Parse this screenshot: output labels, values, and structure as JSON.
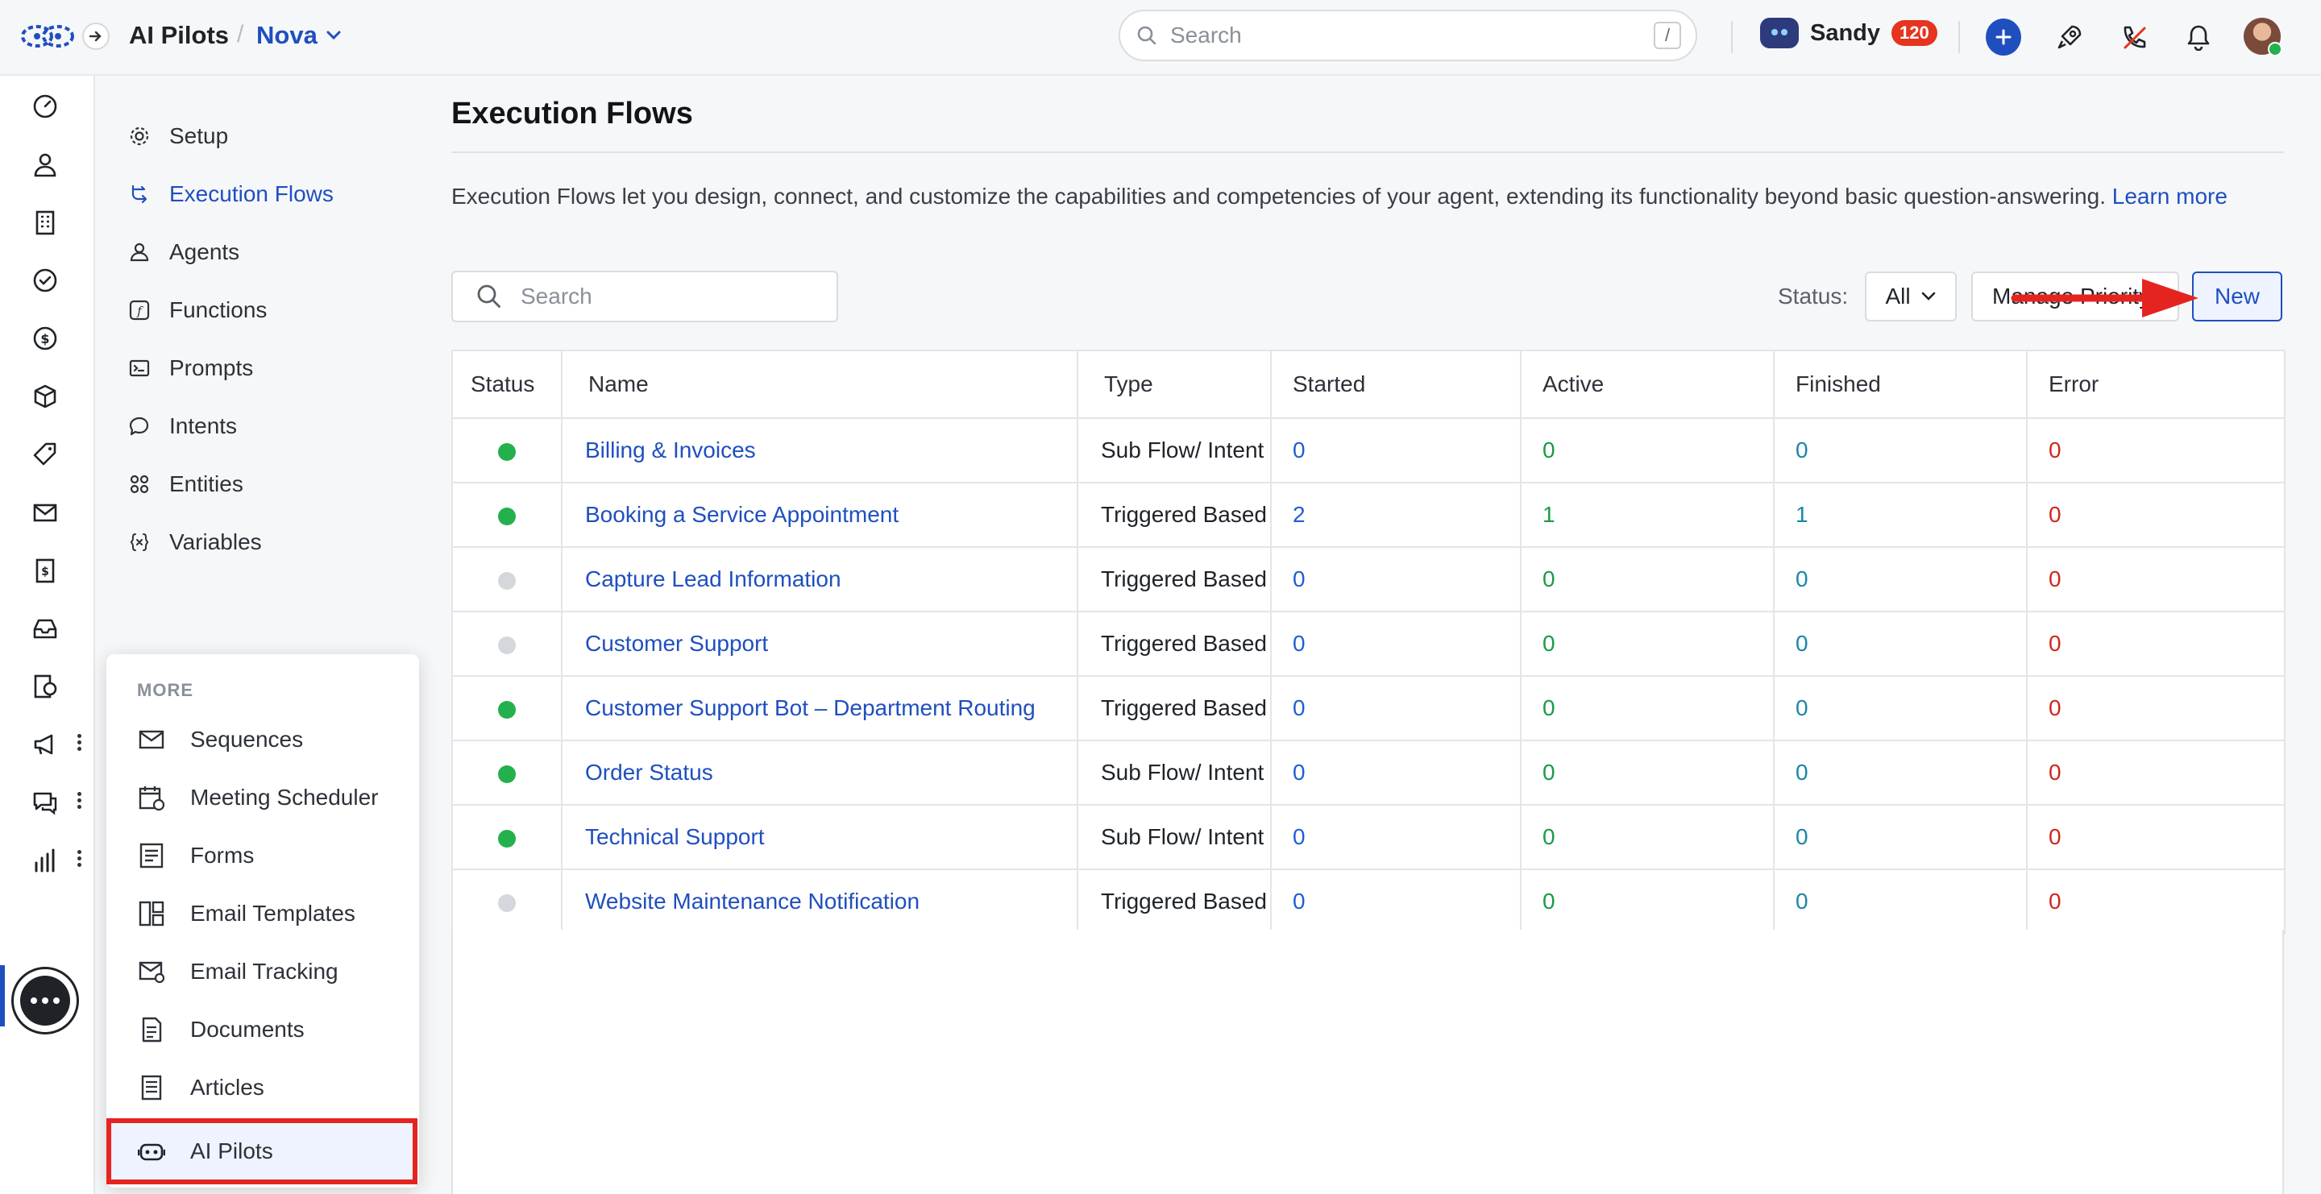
{
  "header": {
    "app_title": "AI Pilots",
    "crumb_separator": "/",
    "app_name": "Nova",
    "search_placeholder": "Search",
    "search_shortcut": "/",
    "user_name": "Sandy",
    "user_badge": "120"
  },
  "subnav": {
    "items": [
      {
        "label": "Setup",
        "icon": "gear-icon"
      },
      {
        "label": "Execution Flows",
        "icon": "flow-icon",
        "active": true
      },
      {
        "label": "Agents",
        "icon": "agent-icon"
      },
      {
        "label": "Functions",
        "icon": "function-icon"
      },
      {
        "label": "Prompts",
        "icon": "prompt-icon"
      },
      {
        "label": "Intents",
        "icon": "intent-icon"
      },
      {
        "label": "Entities",
        "icon": "entity-icon"
      },
      {
        "label": "Variables",
        "icon": "variable-icon"
      }
    ]
  },
  "main": {
    "title": "Execution Flows",
    "intro_text": "Execution Flows let you design, connect, and customize the capabilities and competencies of your agent, extending its functionality beyond basic question-answering.",
    "intro_link": "Learn more",
    "search_placeholder": "Search",
    "status_label": "Status:",
    "status_value": "All",
    "manage_priority_label": "Manage Priority",
    "new_label": "New"
  },
  "table": {
    "columns": [
      "Status",
      "Name",
      "Type",
      "Started",
      "Active",
      "Finished",
      "Error"
    ],
    "rows": [
      {
        "status": "on",
        "name": "Billing & Invoices",
        "type": "Sub Flow/ Intent",
        "started": "0",
        "active": "0",
        "finished": "0",
        "error": "0"
      },
      {
        "status": "on",
        "name": "Booking a Service Appointment",
        "type": "Triggered Based",
        "started": "2",
        "active": "1",
        "finished": "1",
        "error": "0"
      },
      {
        "status": "off",
        "name": "Capture Lead Information",
        "type": "Triggered Based",
        "started": "0",
        "active": "0",
        "finished": "0",
        "error": "0"
      },
      {
        "status": "off",
        "name": "Customer Support",
        "type": "Triggered Based",
        "started": "0",
        "active": "0",
        "finished": "0",
        "error": "0"
      },
      {
        "status": "on",
        "name": "Customer Support Bot – Department Routing",
        "type": "Triggered Based",
        "started": "0",
        "active": "0",
        "finished": "0",
        "error": "0"
      },
      {
        "status": "on",
        "name": "Order Status",
        "type": "Sub Flow/ Intent",
        "started": "0",
        "active": "0",
        "finished": "0",
        "error": "0"
      },
      {
        "status": "on",
        "name": "Technical Support",
        "type": "Sub Flow/ Intent",
        "started": "0",
        "active": "0",
        "finished": "0",
        "error": "0"
      },
      {
        "status": "off",
        "name": "Website Maintenance Notification",
        "type": "Triggered Based",
        "started": "0",
        "active": "0",
        "finished": "0",
        "error": "0"
      }
    ]
  },
  "more_menu": {
    "heading": "MORE",
    "items": [
      {
        "label": "Sequences",
        "icon": "mail-sequence-icon"
      },
      {
        "label": "Meeting Scheduler",
        "icon": "calendar-icon"
      },
      {
        "label": "Forms",
        "icon": "form-icon"
      },
      {
        "label": "Email Templates",
        "icon": "template-icon"
      },
      {
        "label": "Email Tracking",
        "icon": "email-tracking-icon"
      },
      {
        "label": "Documents",
        "icon": "document-icon"
      },
      {
        "label": "Articles",
        "icon": "article-icon"
      },
      {
        "label": "AI Pilots",
        "icon": "ai-pilot-icon",
        "selected": true
      }
    ]
  },
  "colors": {
    "accent": "#1f4fbf",
    "status_on": "#22b14c",
    "status_off": "#d4d7dc",
    "error": "#d1261c",
    "highlight": "#e52420"
  }
}
